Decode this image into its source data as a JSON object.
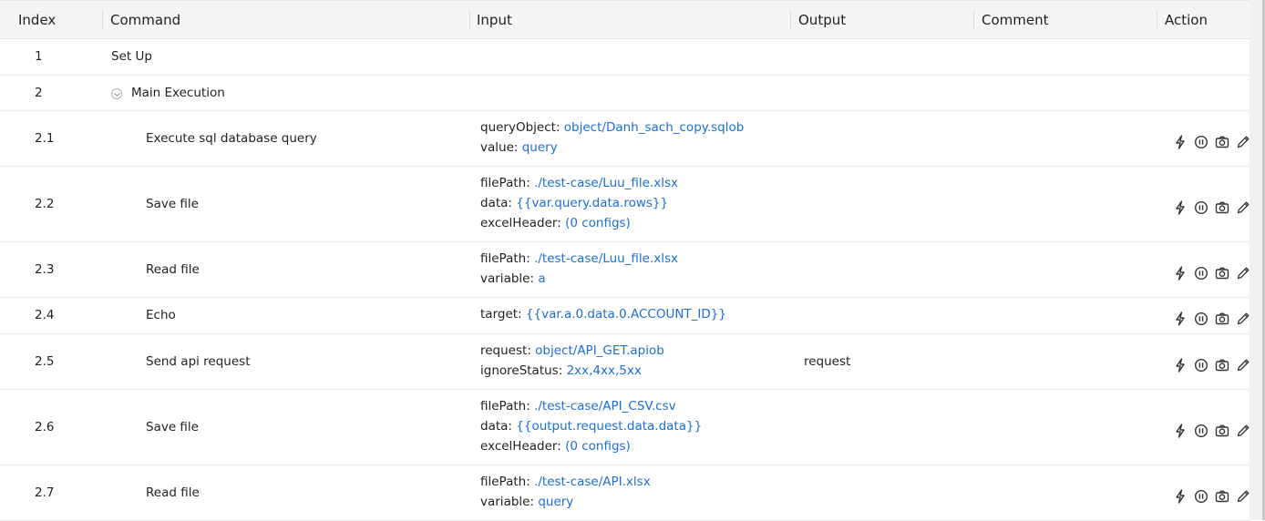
{
  "columns": {
    "index": "Index",
    "command": "Command",
    "input": "Input",
    "output": "Output",
    "comment": "Comment",
    "action": "Action"
  },
  "rows": [
    {
      "index": "1",
      "command": "Set Up"
    },
    {
      "index": "2",
      "command": "Main Execution",
      "collapsible": true
    },
    {
      "index": "2.1",
      "command": "Execute sql database query",
      "inputs": [
        {
          "key": "queryObject:",
          "value": "object/Danh_sach_copy.sqlob"
        },
        {
          "key": "value:",
          "value": "query"
        }
      ]
    },
    {
      "index": "2.2",
      "command": "Save file",
      "inputs": [
        {
          "key": "filePath:",
          "value": "./test-case/Luu_file.xlsx"
        },
        {
          "key": "data:",
          "value": "{{var.query.data.rows}}"
        },
        {
          "key": "excelHeader:",
          "value": "(0 configs)"
        }
      ]
    },
    {
      "index": "2.3",
      "command": "Read file",
      "inputs": [
        {
          "key": "filePath:",
          "value": "./test-case/Luu_file.xlsx"
        },
        {
          "key": "variable:",
          "value": "a"
        }
      ]
    },
    {
      "index": "2.4",
      "command": "Echo",
      "inputs": [
        {
          "key": "target:",
          "value": "{{var.a.0.data.0.ACCOUNT_ID}}"
        }
      ]
    },
    {
      "index": "2.5",
      "command": "Send api request",
      "inputs": [
        {
          "key": "request:",
          "value": "object/API_GET.apiob"
        },
        {
          "key": "ignoreStatus:",
          "value": "2xx,4xx,5xx"
        }
      ],
      "output": "request"
    },
    {
      "index": "2.6",
      "command": "Save file",
      "inputs": [
        {
          "key": "filePath:",
          "value": "./test-case/API_CSV.csv"
        },
        {
          "key": "data:",
          "value": "{{output.request.data.data}}"
        },
        {
          "key": "excelHeader:",
          "value": "(0 configs)"
        }
      ]
    },
    {
      "index": "2.7",
      "command": "Read file",
      "inputs": [
        {
          "key": "filePath:",
          "value": "./test-case/API.xlsx"
        },
        {
          "key": "variable:",
          "value": "query"
        }
      ]
    }
  ],
  "action_icons": [
    "lightning-icon",
    "pause-icon",
    "camera-icon",
    "pencil-icon"
  ],
  "colors": {
    "link": "#1a6fd6",
    "header_bg": "#f5f5f5"
  }
}
